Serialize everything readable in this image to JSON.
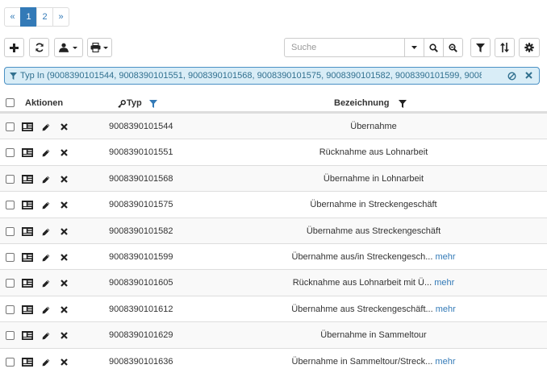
{
  "pagination": {
    "prev": "«",
    "pages": [
      "1",
      "2"
    ],
    "active_page": "1",
    "next": "»"
  },
  "toolbar": {
    "add": "plus-icon",
    "refresh": "refresh-icon",
    "user_menu": "user-dropdown-icon",
    "print_menu": "print-dropdown-icon",
    "search_placeholder": "Suche",
    "filter": "filter-icon",
    "sort": "sort-icon",
    "settings": "gear-icon"
  },
  "filter_bar": {
    "text": "Typ In (9008390101544, 9008390101551, 9008390101568, 9008390101575, 9008390101582, 9008390101599, 900839010..."
  },
  "table": {
    "headers": {
      "actions": "Aktionen",
      "typ": "Typ",
      "bezeichnung": "Bezeichnung"
    },
    "more_label": "mehr",
    "rows": [
      {
        "typ": "9008390101544",
        "bez": "Übernahme",
        "more": false
      },
      {
        "typ": "9008390101551",
        "bez": "Rücknahme aus Lohnarbeit",
        "more": false
      },
      {
        "typ": "9008390101568",
        "bez": "Übernahme in Lohnarbeit",
        "more": false
      },
      {
        "typ": "9008390101575",
        "bez": "Übernahme in Streckengeschäft",
        "more": false
      },
      {
        "typ": "9008390101582",
        "bez": "Übernahme aus Streckengeschäft",
        "more": false
      },
      {
        "typ": "9008390101599",
        "bez": "Übernahme aus/in Streckengesch...",
        "more": true
      },
      {
        "typ": "9008390101605",
        "bez": "Rücknahme aus Lohnarbeit mit Ü...",
        "more": true
      },
      {
        "typ": "9008390101612",
        "bez": "Übernahme aus Streckengeschäft...",
        "more": true
      },
      {
        "typ": "9008390101629",
        "bez": "Übernahme in Sammeltour",
        "more": false
      },
      {
        "typ": "9008390101636",
        "bez": "Übernahme in Sammeltour/Streck...",
        "more": true
      }
    ]
  },
  "colors": {
    "accent": "#337ab7",
    "filter_bg": "#d9edf7",
    "filter_text": "#31708f"
  }
}
